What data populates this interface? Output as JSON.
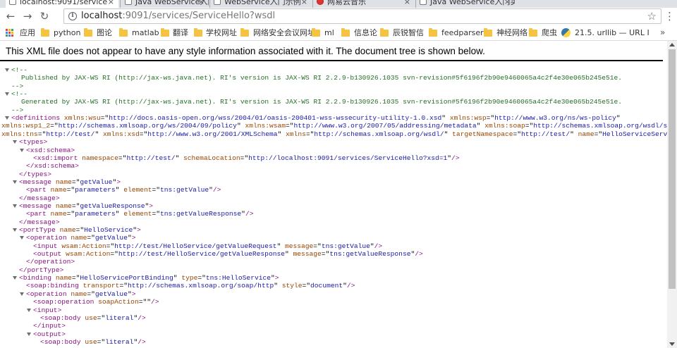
{
  "browser": {
    "tabs": [
      {
        "title": "localhost:9091/service"
      },
      {
        "title": "Java WebService入门实"
      },
      {
        "title": "WebService入门示例"
      },
      {
        "title": "网易云音乐"
      },
      {
        "title": "Java WebService入门实"
      }
    ],
    "url_prefix": "localhost",
    "url_rest": ":9091/services/ServiceHello?wsdl",
    "bookmarks": [
      "应用",
      "python",
      "图论",
      "matlab",
      "翻译",
      "学校网址",
      "网络安全会议网址",
      "ml",
      "信息论",
      "辰锐智信",
      "feedparser",
      "神经网络",
      "爬虫",
      "21.5. urllib — URL I"
    ],
    "more": "»"
  },
  "page": {
    "notice": "This XML file does not appear to have any style information associated with it. The document tree is shown below."
  },
  "xml": {
    "comment_open": "<!--",
    "comment_close": "-->",
    "comment1": "Published by JAX-WS RI (http://jax-ws.java.net). RI's version is JAX-WS RI 2.2.9-b130926.1035 svn-revision#5f6196f2b90e9460065a4c2f4e30e065b245e51e.",
    "comment2": "Generated by JAX-WS RI (http://jax-ws.java.net). RI's version is JAX-WS RI 2.2.9-b130926.1035 svn-revision#5f6196f2b90e9460065a4c2f4e30e065b245e51e.",
    "lines": [
      [
        [
          "tg",
          "<definitions "
        ],
        [
          "an",
          "xmlns:wsu"
        ],
        [
          "pt",
          "=\""
        ],
        [
          "av",
          "http://docs.oasis-open.org/wss/2004/01/oasis-200401-wss-wssecurity-utility-1.0.xsd"
        ],
        [
          "pt",
          "\" "
        ],
        [
          "an",
          "xmlns:wsp"
        ],
        [
          "pt",
          "=\""
        ],
        [
          "av",
          "http://www.w3.org/ns/ws-policy"
        ],
        [
          "pt",
          "\""
        ]
      ],
      [
        [
          "an",
          "xmlns:wsp1_2"
        ],
        [
          "pt",
          "=\""
        ],
        [
          "av",
          "http://schemas.xmlsoap.org/ws/2004/09/policy"
        ],
        [
          "pt",
          "\" "
        ],
        [
          "an",
          "xmlns:wsam"
        ],
        [
          "pt",
          "=\""
        ],
        [
          "av",
          "http://www.w3.org/2007/05/addressing/metadata"
        ],
        [
          "pt",
          "\" "
        ],
        [
          "an",
          "xmlns:soap"
        ],
        [
          "pt",
          "=\""
        ],
        [
          "av",
          "http://schemas.xmlsoap.org/wsdl/soap/"
        ],
        [
          "pt",
          "\""
        ]
      ],
      [
        [
          "an",
          "xmlns:tns"
        ],
        [
          "pt",
          "=\""
        ],
        [
          "av",
          "http://test/"
        ],
        [
          "pt",
          "\" "
        ],
        [
          "an",
          "xmlns:xsd"
        ],
        [
          "pt",
          "=\""
        ],
        [
          "av",
          "http://www.w3.org/2001/XMLSchema"
        ],
        [
          "pt",
          "\" "
        ],
        [
          "an",
          "xmlns"
        ],
        [
          "pt",
          "=\""
        ],
        [
          "av",
          "http://schemas.xmlsoap.org/wsdl/"
        ],
        [
          "pt",
          "\" "
        ],
        [
          "an",
          "targetNamespace"
        ],
        [
          "pt",
          "=\""
        ],
        [
          "av",
          "http://test/"
        ],
        [
          "pt",
          "\" "
        ],
        [
          "an",
          "name"
        ],
        [
          "pt",
          "=\""
        ],
        [
          "av",
          "HelloServiceService"
        ],
        [
          "pt",
          "\""
        ],
        [
          "tg",
          ">"
        ]
      ],
      [
        [
          "tg",
          "<types>"
        ]
      ],
      [
        [
          "tg",
          "<xsd:schema>"
        ]
      ],
      [
        [
          "tg",
          "<xsd:import "
        ],
        [
          "an",
          "namespace"
        ],
        [
          "pt",
          "=\""
        ],
        [
          "av",
          "http://test/"
        ],
        [
          "pt",
          "\" "
        ],
        [
          "an",
          "schemaLocation"
        ],
        [
          "pt",
          "=\""
        ],
        [
          "av",
          "http://localhost:9091/services/ServiceHello?xsd=1"
        ],
        [
          "pt",
          "\""
        ],
        [
          "tg",
          "/>"
        ]
      ],
      [
        [
          "tg",
          "</xsd:schema>"
        ]
      ],
      [
        [
          "tg",
          "</types>"
        ]
      ],
      [
        [
          "tg",
          "<message "
        ],
        [
          "an",
          "name"
        ],
        [
          "pt",
          "=\""
        ],
        [
          "av",
          "getValue"
        ],
        [
          "pt",
          "\""
        ],
        [
          "tg",
          ">"
        ]
      ],
      [
        [
          "tg",
          "<part "
        ],
        [
          "an",
          "name"
        ],
        [
          "pt",
          "=\""
        ],
        [
          "av",
          "parameters"
        ],
        [
          "pt",
          "\" "
        ],
        [
          "an",
          "element"
        ],
        [
          "pt",
          "=\""
        ],
        [
          "av",
          "tns:getValue"
        ],
        [
          "pt",
          "\""
        ],
        [
          "tg",
          "/>"
        ]
      ],
      [
        [
          "tg",
          "</message>"
        ]
      ],
      [
        [
          "tg",
          "<message "
        ],
        [
          "an",
          "name"
        ],
        [
          "pt",
          "=\""
        ],
        [
          "av",
          "getValueResponse"
        ],
        [
          "pt",
          "\""
        ],
        [
          "tg",
          ">"
        ]
      ],
      [
        [
          "tg",
          "<part "
        ],
        [
          "an",
          "name"
        ],
        [
          "pt",
          "=\""
        ],
        [
          "av",
          "parameters"
        ],
        [
          "pt",
          "\" "
        ],
        [
          "an",
          "element"
        ],
        [
          "pt",
          "=\""
        ],
        [
          "av",
          "tns:getValueResponse"
        ],
        [
          "pt",
          "\""
        ],
        [
          "tg",
          "/>"
        ]
      ],
      [
        [
          "tg",
          "</message>"
        ]
      ],
      [
        [
          "tg",
          "<portType "
        ],
        [
          "an",
          "name"
        ],
        [
          "pt",
          "=\""
        ],
        [
          "av",
          "HelloService"
        ],
        [
          "pt",
          "\""
        ],
        [
          "tg",
          ">"
        ]
      ],
      [
        [
          "tg",
          "<operation "
        ],
        [
          "an",
          "name"
        ],
        [
          "pt",
          "=\""
        ],
        [
          "av",
          "getValue"
        ],
        [
          "pt",
          "\""
        ],
        [
          "tg",
          ">"
        ]
      ],
      [
        [
          "tg",
          "<input "
        ],
        [
          "an",
          "wsam:Action"
        ],
        [
          "pt",
          "=\""
        ],
        [
          "av",
          "http://test/HelloService/getValueRequest"
        ],
        [
          "pt",
          "\" "
        ],
        [
          "an",
          "message"
        ],
        [
          "pt",
          "=\""
        ],
        [
          "av",
          "tns:getValue"
        ],
        [
          "pt",
          "\""
        ],
        [
          "tg",
          "/>"
        ]
      ],
      [
        [
          "tg",
          "<output "
        ],
        [
          "an",
          "wsam:Action"
        ],
        [
          "pt",
          "=\""
        ],
        [
          "av",
          "http://test/HelloService/getValueResponse"
        ],
        [
          "pt",
          "\" "
        ],
        [
          "an",
          "message"
        ],
        [
          "pt",
          "=\""
        ],
        [
          "av",
          "tns:getValueResponse"
        ],
        [
          "pt",
          "\""
        ],
        [
          "tg",
          "/>"
        ]
      ],
      [
        [
          "tg",
          "</operation>"
        ]
      ],
      [
        [
          "tg",
          "</portType>"
        ]
      ],
      [
        [
          "tg",
          "<binding "
        ],
        [
          "an",
          "name"
        ],
        [
          "pt",
          "=\""
        ],
        [
          "av",
          "HelloServicePortBinding"
        ],
        [
          "pt",
          "\" "
        ],
        [
          "an",
          "type"
        ],
        [
          "pt",
          "=\""
        ],
        [
          "av",
          "tns:HelloService"
        ],
        [
          "pt",
          "\""
        ],
        [
          "tg",
          ">"
        ]
      ],
      [
        [
          "tg",
          "<soap:binding "
        ],
        [
          "an",
          "transport"
        ],
        [
          "pt",
          "=\""
        ],
        [
          "av",
          "http://schemas.xmlsoap.org/soap/http"
        ],
        [
          "pt",
          "\" "
        ],
        [
          "an",
          "style"
        ],
        [
          "pt",
          "=\""
        ],
        [
          "av",
          "document"
        ],
        [
          "pt",
          "\""
        ],
        [
          "tg",
          "/>"
        ]
      ],
      [
        [
          "tg",
          "<operation "
        ],
        [
          "an",
          "name"
        ],
        [
          "pt",
          "=\""
        ],
        [
          "av",
          "getValue"
        ],
        [
          "pt",
          "\""
        ],
        [
          "tg",
          ">"
        ]
      ],
      [
        [
          "tg",
          "<soap:operation "
        ],
        [
          "an",
          "soapAction"
        ],
        [
          "pt",
          "=\"\""
        ],
        [
          "tg",
          "/>"
        ]
      ],
      [
        [
          "tg",
          "<input>"
        ]
      ],
      [
        [
          "tg",
          "<soap:body "
        ],
        [
          "an",
          "use"
        ],
        [
          "pt",
          "=\""
        ],
        [
          "av",
          "literal"
        ],
        [
          "pt",
          "\""
        ],
        [
          "tg",
          "/>"
        ]
      ],
      [
        [
          "tg",
          "</input>"
        ]
      ],
      [
        [
          "tg",
          "<output>"
        ]
      ],
      [
        [
          "tg",
          "<soap:body "
        ],
        [
          "an",
          "use"
        ],
        [
          "pt",
          "=\""
        ],
        [
          "av",
          "literal"
        ],
        [
          "pt",
          "\""
        ],
        [
          "tg",
          "/>"
        ]
      ]
    ]
  }
}
